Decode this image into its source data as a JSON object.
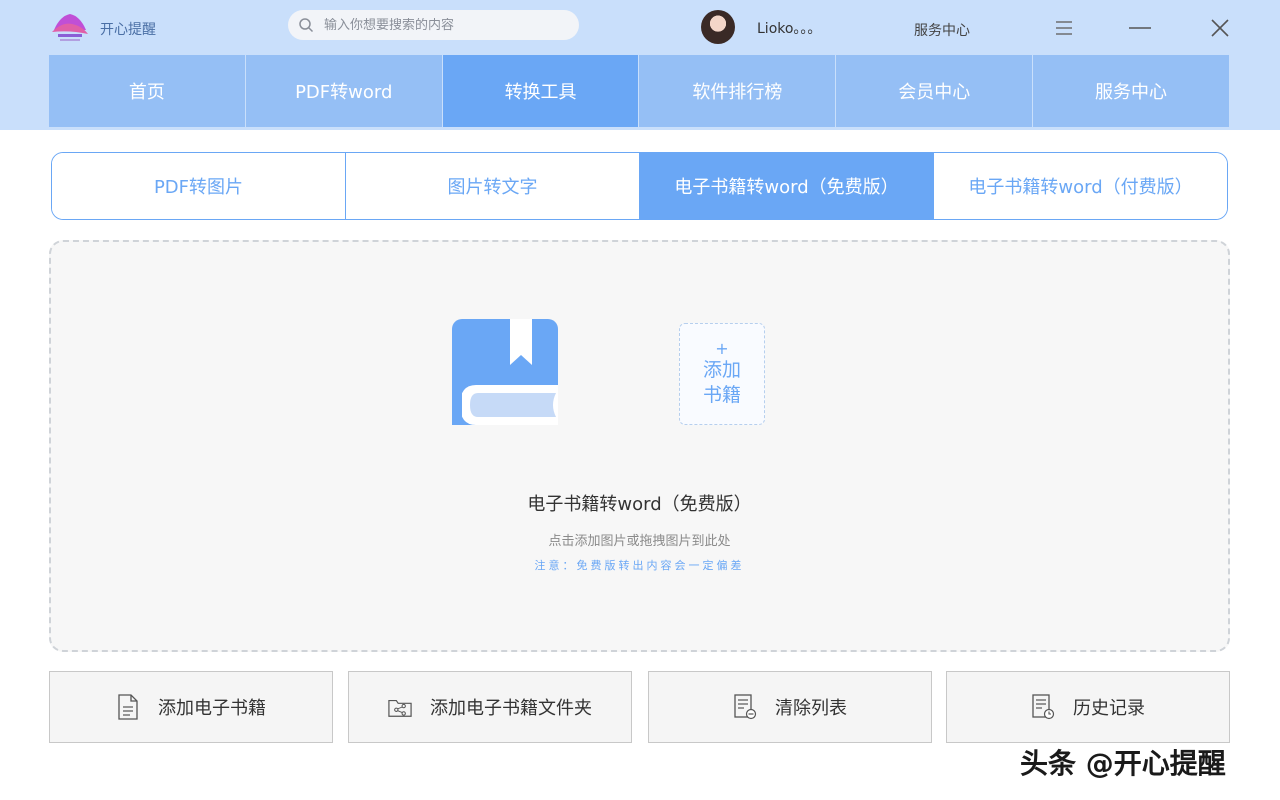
{
  "app": {
    "name": "开心提醒"
  },
  "search": {
    "placeholder": "输入你想要搜索的内容"
  },
  "user": {
    "name": "Lioko。。。"
  },
  "header": {
    "service_link": "服务中心"
  },
  "nav": {
    "items": [
      {
        "label": "首页"
      },
      {
        "label": "PDF转word"
      },
      {
        "label": "转换工具"
      },
      {
        "label": "软件排行榜"
      },
      {
        "label": "会员中心"
      },
      {
        "label": "服务中心"
      }
    ],
    "active_index": 2
  },
  "subtabs": {
    "items": [
      {
        "label": "PDF转图片"
      },
      {
        "label": "图片转文字"
      },
      {
        "label": "电子书籍转word（免费版）"
      },
      {
        "label": "电子书籍转word（付费版）"
      }
    ],
    "active_index": 2
  },
  "dropzone": {
    "add_plus": "+",
    "add_line1": "添加",
    "add_line2": "书籍",
    "title": "电子书籍转word（免费版）",
    "hint": "点击添加图片或拖拽图片到此处",
    "note": "注意：免费版转出内容会一定偏差"
  },
  "actions": {
    "add_ebook": "添加电子书籍",
    "add_folder": "添加电子书籍文件夹",
    "clear_list": "清除列表",
    "history": "历史记录"
  },
  "watermark": "头条 @开心提醒",
  "colors": {
    "accent": "#6aa7f5",
    "nav_bg": "#95bff5",
    "header_bg": "#c9dffb"
  }
}
